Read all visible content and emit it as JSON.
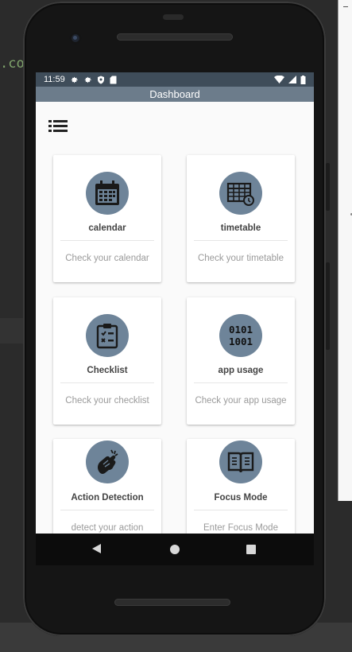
{
  "ide": {
    "code_fragment": ".co"
  },
  "status_bar": {
    "time": "11:59"
  },
  "app_bar": {
    "title": "Dashboard"
  },
  "cards": [
    {
      "title": "calendar",
      "description": "Check your calendar",
      "icon": "calendar-icon"
    },
    {
      "title": "timetable",
      "description": "Check your timetable",
      "icon": "timetable-icon"
    },
    {
      "title": "Checklist",
      "description": "Check your checklist",
      "icon": "checklist-icon"
    },
    {
      "title": "app usage",
      "description": "Check your app usage",
      "icon": "binary-icon",
      "icon_text": [
        "0101",
        "1001"
      ]
    },
    {
      "title": "Action Detection",
      "description": "detect your action",
      "icon": "action-detection-icon"
    },
    {
      "title": "Focus Mode",
      "description": "Enter Focus Mode",
      "icon": "book-icon"
    }
  ],
  "colors": {
    "status_bar": "#3f4d5a",
    "app_bar": "#6c7c8b",
    "icon_circle": "#6e8499",
    "background": "#fafafa"
  }
}
